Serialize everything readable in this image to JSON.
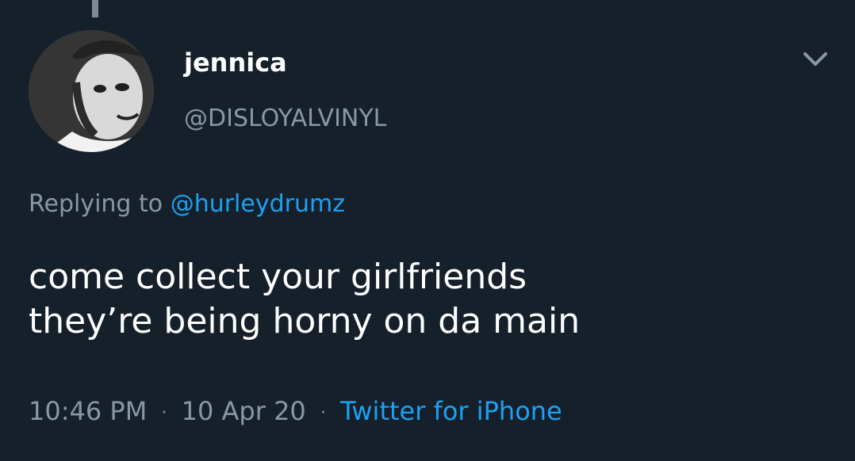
{
  "tweet": {
    "author": {
      "display_name": "jennica",
      "handle": "@DISLOYALVINYL",
      "avatar_icon": "profile-photo"
    },
    "reply": {
      "prefix": "Replying to",
      "mention": "@hurleydrumz"
    },
    "text_line1": "come collect your girlfriends",
    "text_line2": "they’re being horny on da main",
    "meta": {
      "time": "10:46 PM",
      "separator": "·",
      "date": "10 Apr 20",
      "source": "Twitter for iPhone"
    }
  },
  "colors": {
    "background": "#15202b",
    "primary_text": "#ffffff",
    "secondary_text": "#8899a6",
    "accent": "#1da1f2"
  },
  "icons": {
    "menu": "chevron-down-icon"
  }
}
